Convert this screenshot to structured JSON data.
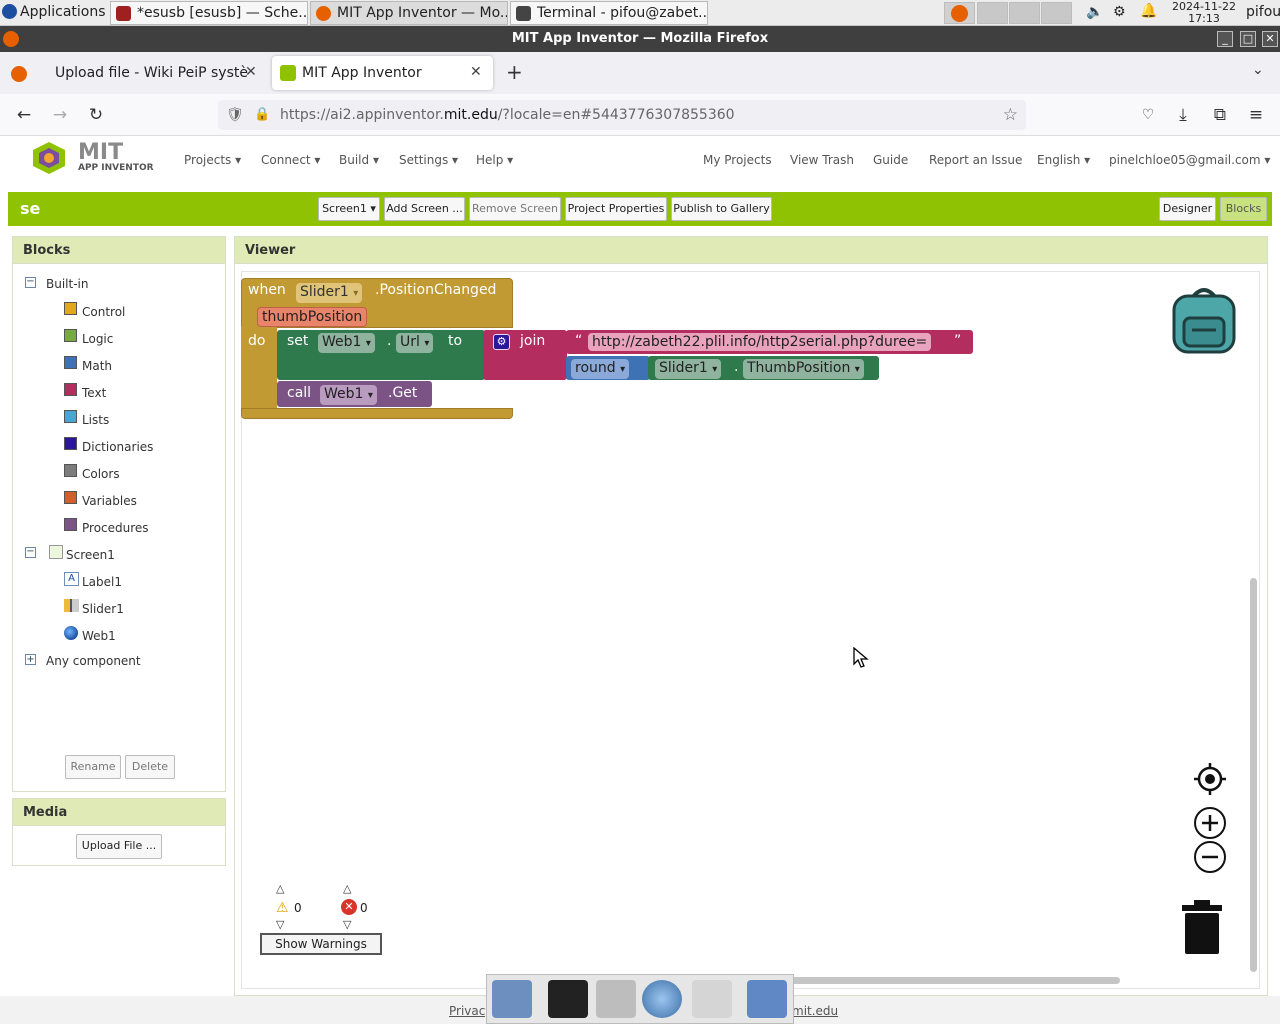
{
  "system_panel": {
    "apps_menu": "Applications",
    "tasks": [
      "*esusb [esusb] — Sche...",
      "MIT App Inventor — Mo...",
      "Terminal - pifou@zabet..."
    ],
    "date": "2024-11-22",
    "time": "17:13",
    "user": "pifou"
  },
  "window": {
    "title": "MIT App Inventor — Mozilla Firefox"
  },
  "browser": {
    "tabs": [
      {
        "label": "Upload file - Wiki PeiP systè"
      },
      {
        "label": "MIT App Inventor"
      }
    ],
    "url_prefix": "https://ai2.appinventor.",
    "url_domain": "mit.edu",
    "url_suffix": "/?locale=en#5443776307855360"
  },
  "app": {
    "logo_mit": "MIT",
    "logo_sub": "APP INVENTOR",
    "menus": [
      "Projects ▾",
      "Connect ▾",
      "Build ▾",
      "Settings ▾",
      "Help ▾"
    ],
    "right_menus": [
      "My Projects",
      "View Trash",
      "Guide",
      "Report an Issue",
      "English ▾",
      "pinelchloe05@gmail.com ▾"
    ],
    "project_name": "se",
    "toolbar": {
      "screen_select": "Screen1 ▾",
      "add_screen": "Add Screen ...",
      "remove_screen": "Remove Screen",
      "project_properties": "Project Properties",
      "publish": "Publish to Gallery",
      "designer": "Designer",
      "blocks": "Blocks"
    }
  },
  "blocks_panel": {
    "title": "Blocks",
    "builtin_label": "Built-in",
    "builtin": [
      {
        "label": "Control",
        "color": "#e1a91a"
      },
      {
        "label": "Logic",
        "color": "#77ab41"
      },
      {
        "label": "Math",
        "color": "#3f71b5"
      },
      {
        "label": "Text",
        "color": "#b32d5e"
      },
      {
        "label": "Lists",
        "color": "#49a6d4"
      },
      {
        "label": "Dictionaries",
        "color": "#2d1799"
      },
      {
        "label": "Colors",
        "color": "#7d7d7d"
      },
      {
        "label": "Variables",
        "color": "#d05f2d"
      },
      {
        "label": "Procedures",
        "color": "#7c5385"
      }
    ],
    "screen_label": "Screen1",
    "components": [
      "Label1",
      "Slider1",
      "Web1"
    ],
    "any_component": "Any component",
    "rename": "Rename",
    "delete": "Delete"
  },
  "media_panel": {
    "title": "Media",
    "upload": "Upload File ..."
  },
  "viewer": {
    "title": "Viewer",
    "event_block": {
      "when": "when",
      "component": "Slider1",
      "event": ".PositionChanged",
      "param": "thumbPosition",
      "do": "do"
    },
    "set_block": {
      "set": "set",
      "component": "Web1",
      "dot": ".",
      "property": "Url",
      "to": "to"
    },
    "join_block": {
      "label": "join",
      "string_open": "“",
      "string_value": "http://zabeth22.plil.info/http2serial.php?duree=",
      "string_close": "”"
    },
    "round_block": {
      "label": "round"
    },
    "getter_block": {
      "component": "Slider1",
      "dot": ".",
      "property": "ThumbPosition"
    },
    "call_block": {
      "call": "call",
      "component": "Web1",
      "method": ".Get"
    },
    "warnings_count": "0",
    "errors_count": "0",
    "show_warnings": "Show Warnings"
  },
  "footer": {
    "privacy": "Privacy",
    "domain": "mit.edu"
  }
}
